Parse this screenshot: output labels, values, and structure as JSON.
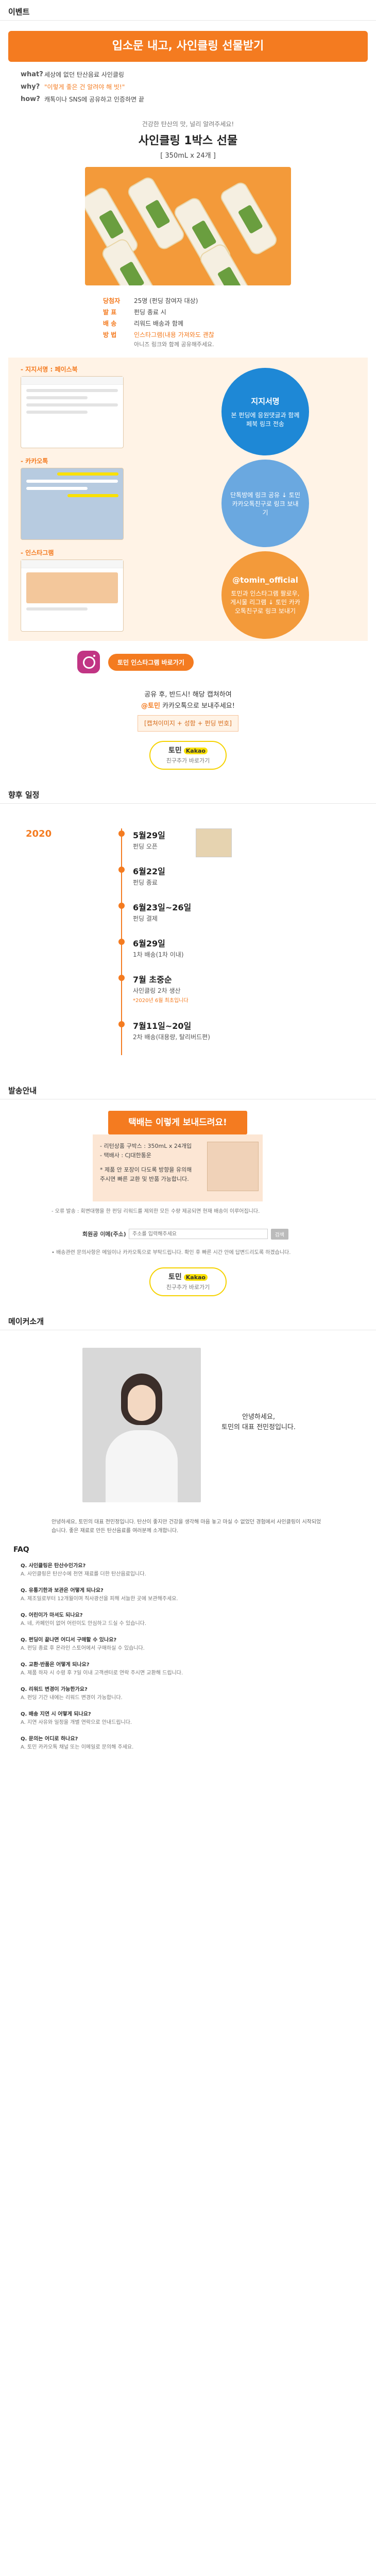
{
  "event_header": "이벤트",
  "event": {
    "banner": "입소문 내고, 사인클링 선물받기",
    "rows": [
      {
        "key": "what?",
        "value": "세상에 없던 탄산음료 사인클링"
      },
      {
        "key": "why?",
        "value": "\"이렇게 좋은 건 알려야 해 빗!\""
      },
      {
        "key": "how?",
        "value": "캐톡이나 SNS에 공유하고 인증하면 끝"
      }
    ],
    "intro_tag": "건강한 탄산의 맛, 널리 알려주세요!",
    "intro_title": "사인클링 1박스 선물",
    "intro_sub": "[ 350mL x 24개 ]",
    "winners": [
      {
        "key": "당첨자",
        "value": "25명 (펀딩 참여자 대상)",
        "note": ""
      },
      {
        "key": "발  표",
        "value": "펀딩 종료 시",
        "note": ""
      },
      {
        "key": "배  송",
        "value": "리워드 배송과 함께",
        "note": ""
      },
      {
        "key": "방  법",
        "value": "인스타그램(내용 가져와도 괜찮",
        "note": "아니즈 링크와 함께 공유해주세요."
      }
    ],
    "instructions": [
      {
        "label": "- 지지서명 : 페이스북",
        "circle_big": "지지서명",
        "circle_text": "본 펀딩에 응원댓글과 함께 페북 링크 전송",
        "color": "#1e88d6"
      },
      {
        "label": "- 카카오톡",
        "circle_big": "",
        "circle_text": "단톡방에 링크 공유 ↓ 토민 카카오톡친구로 링크 보내기",
        "color": "#6aa8e0"
      },
      {
        "label": "- 인스타그램",
        "circle_big": "@tomin_official",
        "circle_text": "토민과 인스타그램 팔로우, 게시물 리그램 ↓ 토민 카카오톡친구로 링크 보내기",
        "color": "#f39a3a"
      }
    ],
    "insta_button": "토민 인스타그램 바로가기",
    "kakao_line1": "공유 후, 반드시! 해당 캡쳐하여",
    "kakao_line2_accent": "@토민",
    "kakao_line2_rest": " 카카오톡으로 보내주세요!",
    "kakao_tag": "[캡쳐이미지 + 성함 + 펀딩 번호]",
    "kakao_btn_title": "토민",
    "kakao_btn_channel": "Kakao",
    "kakao_btn_sub": "친구추가 바로가기"
  },
  "schedule_header": "향후 일정",
  "schedule": {
    "year": "2020",
    "items": [
      {
        "date": "5월29일",
        "desc": "펀딩 오픈",
        "note": ""
      },
      {
        "date": "6월22일",
        "desc": "펀딩 종료",
        "note": ""
      },
      {
        "date": "6월23일~26일",
        "desc": "펀딩 결제",
        "note": ""
      },
      {
        "date": "6월29일",
        "desc": "1차 배송(1차 이내)",
        "note": ""
      },
      {
        "date": "7월 초중순",
        "desc": "사인클링 2차 생산",
        "note": "*2020년 6월 최초입니다"
      },
      {
        "date": "7월11일~20일",
        "desc": "2차 배송(대용량, 탈리버드편)",
        "note": ""
      }
    ]
  },
  "shipping_header": "발송안내",
  "shipping": {
    "banner": "택배는 이렇게 보내드려요!",
    "box_lines": [
      "- 리턴상품 구박스 : 350mL x 24개입",
      "- 택배사 : CJ대한통운",
      "* 제품 안 포장이 다도록 방향을 유의해",
      "주시면 빠른 교환 및 반품 가능합니다."
    ],
    "notes": "- 오류 발송 : 회변대행을 한 펀딩 리워드를 제외한 모든 수량 제공되면 현재 배송이 이루어집니다.",
    "address_label": "회원공 이메(주소)",
    "address_placeholder": "주소를 입력해주세요",
    "address_button": "검색",
    "bullets": "• 배송관련 문의사항은 메일이나 카카오톡으로 부탁드립니다. 확인 후 빠른 시간 안에 답변드리도록 하겠습니다."
  },
  "maker_header": "메이커소개",
  "maker": {
    "greeting": "안녕하세요,",
    "name_line": "토민의 대표 전민정입니다.",
    "body": "안녕하세요, 토민의 대표 전민정입니다. 탄산이 좋지만 건강을 생각해 마음 놓고 마실 수 없었던 경험에서 사인클링이 시작되었습니다. 좋은 재료로 만든 탄산음료를 여러분께 소개합니다."
  },
  "faq_title": "FAQ",
  "faq": [
    {
      "q": "Q. 사인클링은 탄산수인가요?",
      "a": "A. 사인클링은 탄산수에 천연 재료를 더한 탄산음료입니다."
    },
    {
      "q": "Q. 유통기한과 보관은 어떻게 되나요?",
      "a": "A. 제조일로부터 12개월이며 직사광선을 피해 서늘한 곳에 보관해주세요."
    },
    {
      "q": "Q. 어린이가 마셔도 되나요?",
      "a": "A. 네, 카페인이 없어 어린이도 안심하고 드실 수 있습니다."
    },
    {
      "q": "Q. 펀딩이 끝나면 어디서 구매할 수 있나요?",
      "a": "A. 펀딩 종료 후 온라인 스토어에서 구매하실 수 있습니다."
    },
    {
      "q": "Q. 교환·반품은 어떻게 되나요?",
      "a": "A. 제품 하자 시 수령 후 7일 이내 고객센터로 연락 주시면 교환해 드립니다."
    },
    {
      "q": "Q. 리워드 변경이 가능한가요?",
      "a": "A. 펀딩 기간 내에는 리워드 변경이 가능합니다."
    },
    {
      "q": "Q. 배송 지연 시 어떻게 되나요?",
      "a": "A. 지연 사유와 일정을 개별 연락으로 안내드립니다."
    },
    {
      "q": "Q. 문의는 어디로 하나요?",
      "a": "A. 토민 카카오톡 채널 또는 이메일로 문의해 주세요."
    }
  ],
  "colors": {
    "accent": "#f47b20",
    "kakao": "#fae100"
  }
}
